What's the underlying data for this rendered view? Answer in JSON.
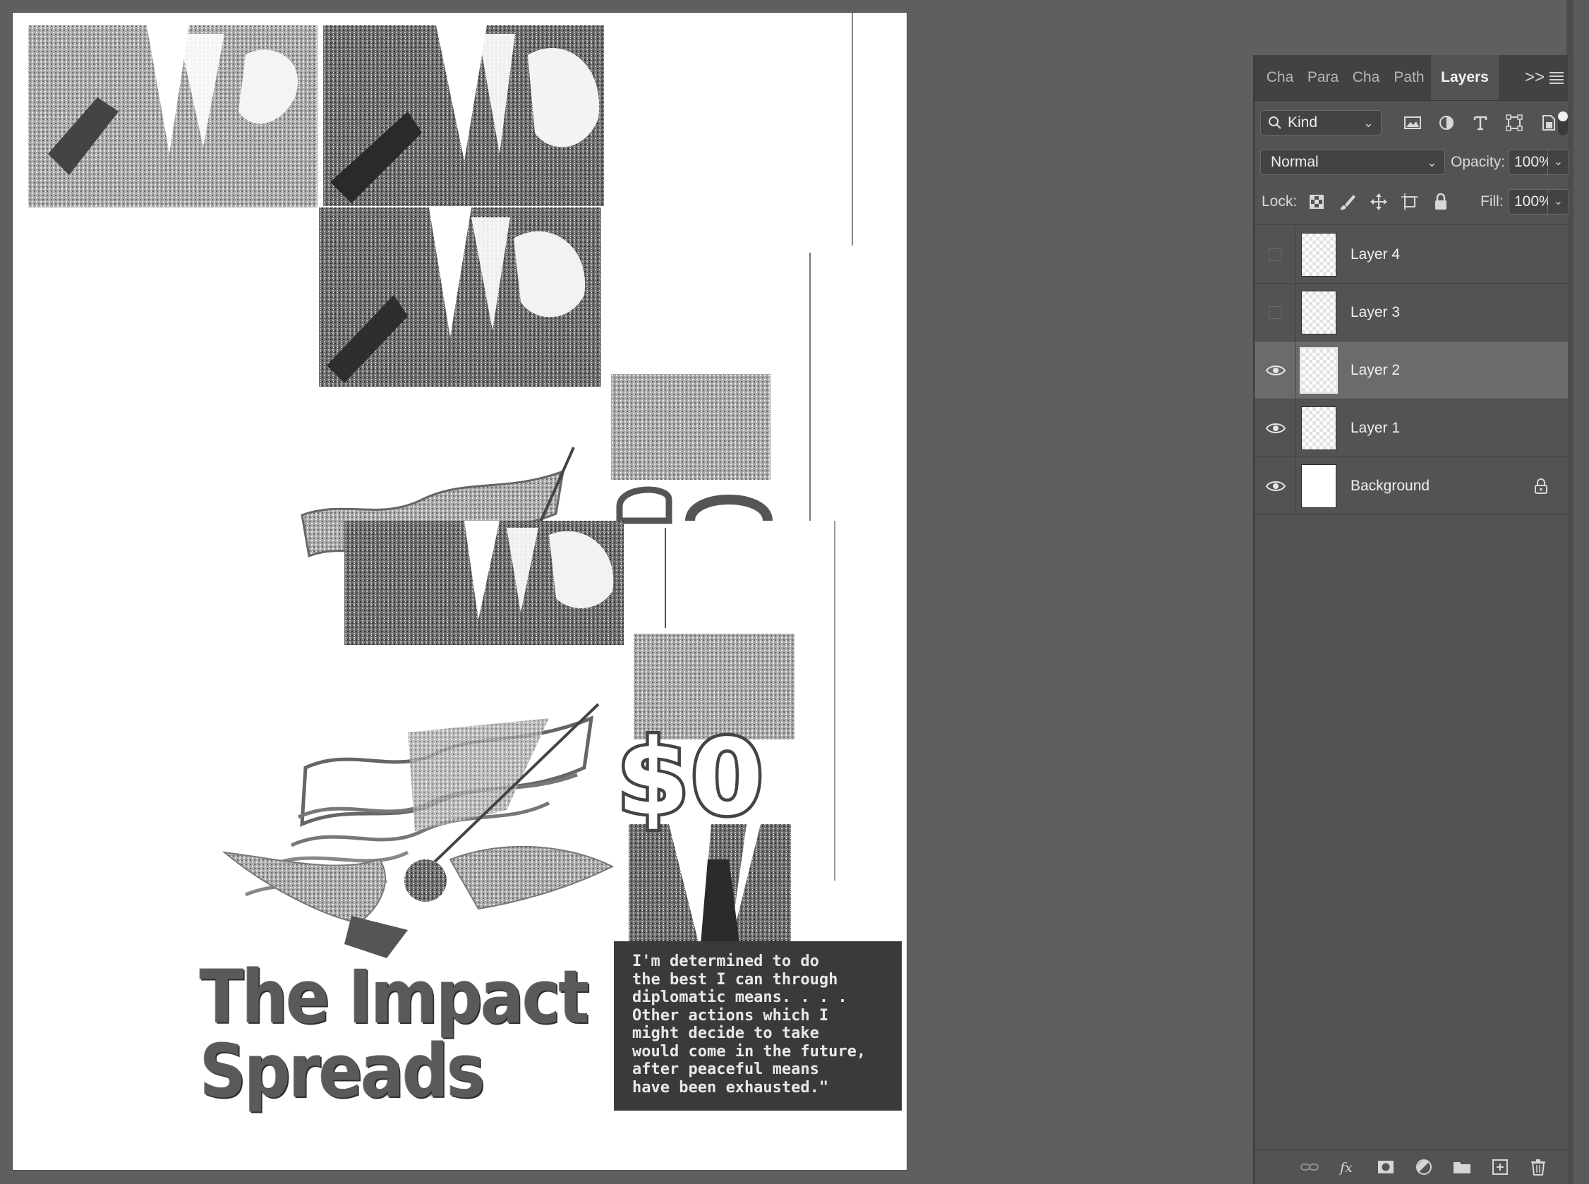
{
  "canvas": {
    "headline_line1": "The Impact",
    "headline_line2": "Spreads",
    "money_text": "$0",
    "quote_lines": [
      "I'm determined to do",
      "the best I can through",
      "diplomatic means. . . .",
      "Other actions which I",
      "might decide to take",
      "would come in the future,",
      "after peaceful means",
      "have been exhausted.\""
    ]
  },
  "panel": {
    "tabs": [
      "Cha",
      "Para",
      "Cha",
      "Path",
      "Layers"
    ],
    "active_tab": "Layers",
    "more_glyph": ">>",
    "filter": {
      "label": "Kind"
    },
    "blend_mode": "Normal",
    "opacity_label": "Opacity:",
    "opacity_value": "100%",
    "lock_label": "Lock:",
    "fill_label": "Fill:",
    "fill_value": "100%",
    "layers": [
      {
        "name": "Layer 4",
        "visible": false,
        "selected": false,
        "locked": false
      },
      {
        "name": "Layer 3",
        "visible": false,
        "selected": false,
        "locked": false
      },
      {
        "name": "Layer 2",
        "visible": true,
        "selected": true,
        "locked": false
      },
      {
        "name": "Layer 1",
        "visible": true,
        "selected": false,
        "locked": false
      },
      {
        "name": "Background",
        "visible": true,
        "selected": false,
        "locked": true
      }
    ]
  },
  "colors": {
    "workspace": "#5f5f5f",
    "panel": "#535353",
    "selected_row": "#6b6b6b",
    "text": "#f0f0f0"
  }
}
